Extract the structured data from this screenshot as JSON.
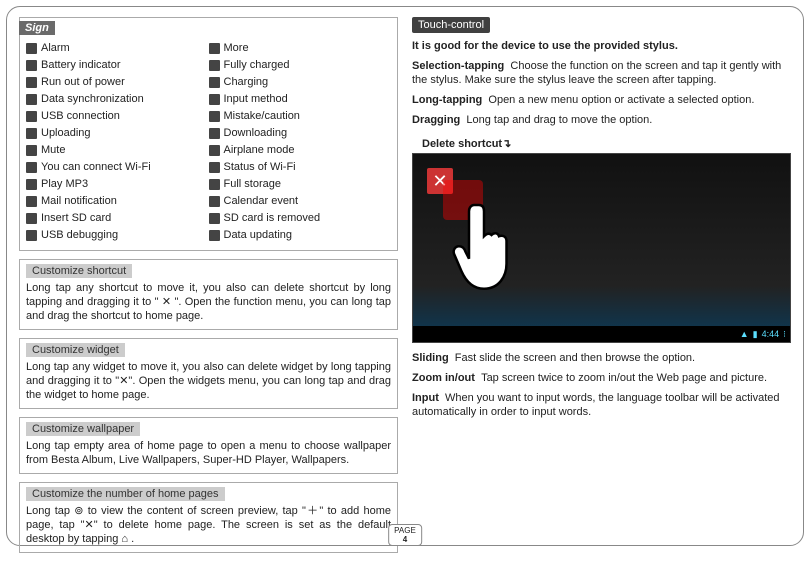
{
  "left": {
    "sign_title": "Sign",
    "sign_col1": [
      "Alarm",
      "Battery indicator",
      "Run out of power",
      "Data synchronization",
      "USB connection",
      "Uploading",
      "Mute",
      "You can connect Wi-Fi",
      "Play MP3",
      "Mail notification",
      "Insert SD card",
      "USB debugging"
    ],
    "sign_col2": [
      "More",
      "Fully charged",
      "Charging",
      "Input method",
      "Mistake/caution",
      "Downloading",
      "Airplane mode",
      "Status of Wi-Fi",
      "Full storage",
      "Calendar event",
      "SD card is removed",
      "Data updating"
    ],
    "custom_shortcut_title": "Customize shortcut",
    "custom_shortcut_body": "Long tap any shortcut to move it, you also can delete shortcut by long tapping and dragging it to \" ✕ \". Open the function menu, you can long tap and drag the shortcut to home page.",
    "custom_widget_title": "Customize widget",
    "custom_widget_body": "Long tap any widget to move it, you also can delete widget by long tapping and dragging it to \"✕\". Open the widgets menu, you can long tap and drag the widget to home page.",
    "custom_wallpaper_title": "Customize wallpaper",
    "custom_wallpaper_body": "Long tap empty area of home page to open a menu to choose wallpaper from Besta Album, Live Wallpapers, Super-HD Player, Wallpapers.",
    "custom_pages_title": "Customize the number of home pages",
    "custom_pages_body": "Long tap ⊚ to view the content of screen preview, tap \"＋\" to add home page, tap \"✕\" to delete home page. The screen is set as the default desktop by tapping ⌂ ."
  },
  "right": {
    "touch_title": "Touch-control",
    "intro_bold": "It is good for the device to use the provided stylus.",
    "seltap_t": "Selection-tapping",
    "seltap_b": "Choose the function on the screen and tap it gently with the stylus. Make sure the stylus leave the screen after tapping.",
    "longtap_t": "Long-tapping",
    "longtap_b": "Open a new menu option or activate a selected option.",
    "drag_t": "Dragging",
    "drag_b": "Long tap and drag to move the option.",
    "delshortcut": "Delete shortcut↴",
    "clock": "4:44",
    "sliding_t": "Sliding",
    "sliding_b": "Fast slide the screen and then browse the option.",
    "zoom_t": "Zoom in/out",
    "zoom_b": "Tap screen twice to zoom in/out the Web page and picture.",
    "input_t": "Input",
    "input_b": "When you want to input words, the language toolbar will be activated automatically in order to input words."
  },
  "page": {
    "label": "PAGE",
    "num": "4"
  }
}
